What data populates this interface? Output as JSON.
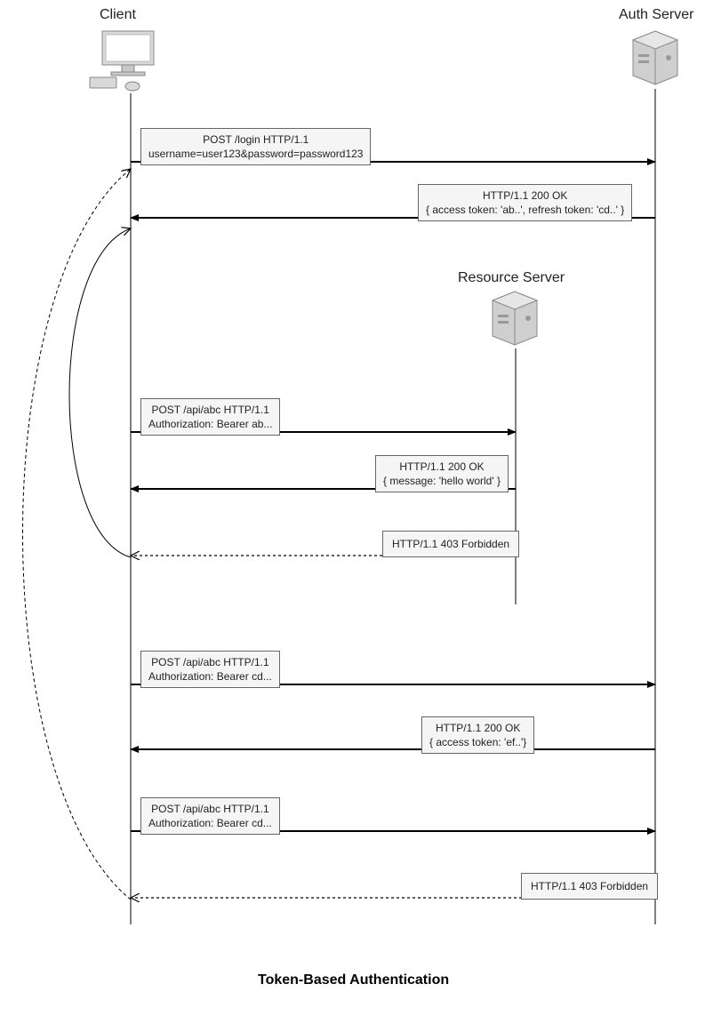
{
  "diagram": {
    "title": "Token-Based Authentication",
    "actors": {
      "client": "Client",
      "auth_server": "Auth Server",
      "resource_server": "Resource Server"
    },
    "messages": {
      "login_req_line1": "POST /login HTTP/1.1",
      "login_req_line2": "username=user123&password=password123",
      "login_resp_line1": "HTTP/1.1 200 OK",
      "login_resp_line2": "{ access token: 'ab..', refresh token: 'cd..' }",
      "api_req1_line1": "POST /api/abc HTTP/1.1",
      "api_req1_line2": "Authorization: Bearer ab...",
      "api_resp1_line1": "HTTP/1.1 200 OK",
      "api_resp1_line2": "{ message: 'hello world' }",
      "api_resp_forbidden1": "HTTP/1.1 403 Forbidden",
      "refresh_req_line1": "POST /api/abc HTTP/1.1",
      "refresh_req_line2": "Authorization: Bearer cd...",
      "refresh_resp_line1": "HTTP/1.1 200 OK",
      "refresh_resp_line2": "{ access token: 'ef..'}",
      "req3_line1": "POST /api/abc HTTP/1.1",
      "req3_line2": "Authorization: Bearer cd...",
      "resp_forbidden2": "HTTP/1.1 403 Forbidden"
    }
  }
}
